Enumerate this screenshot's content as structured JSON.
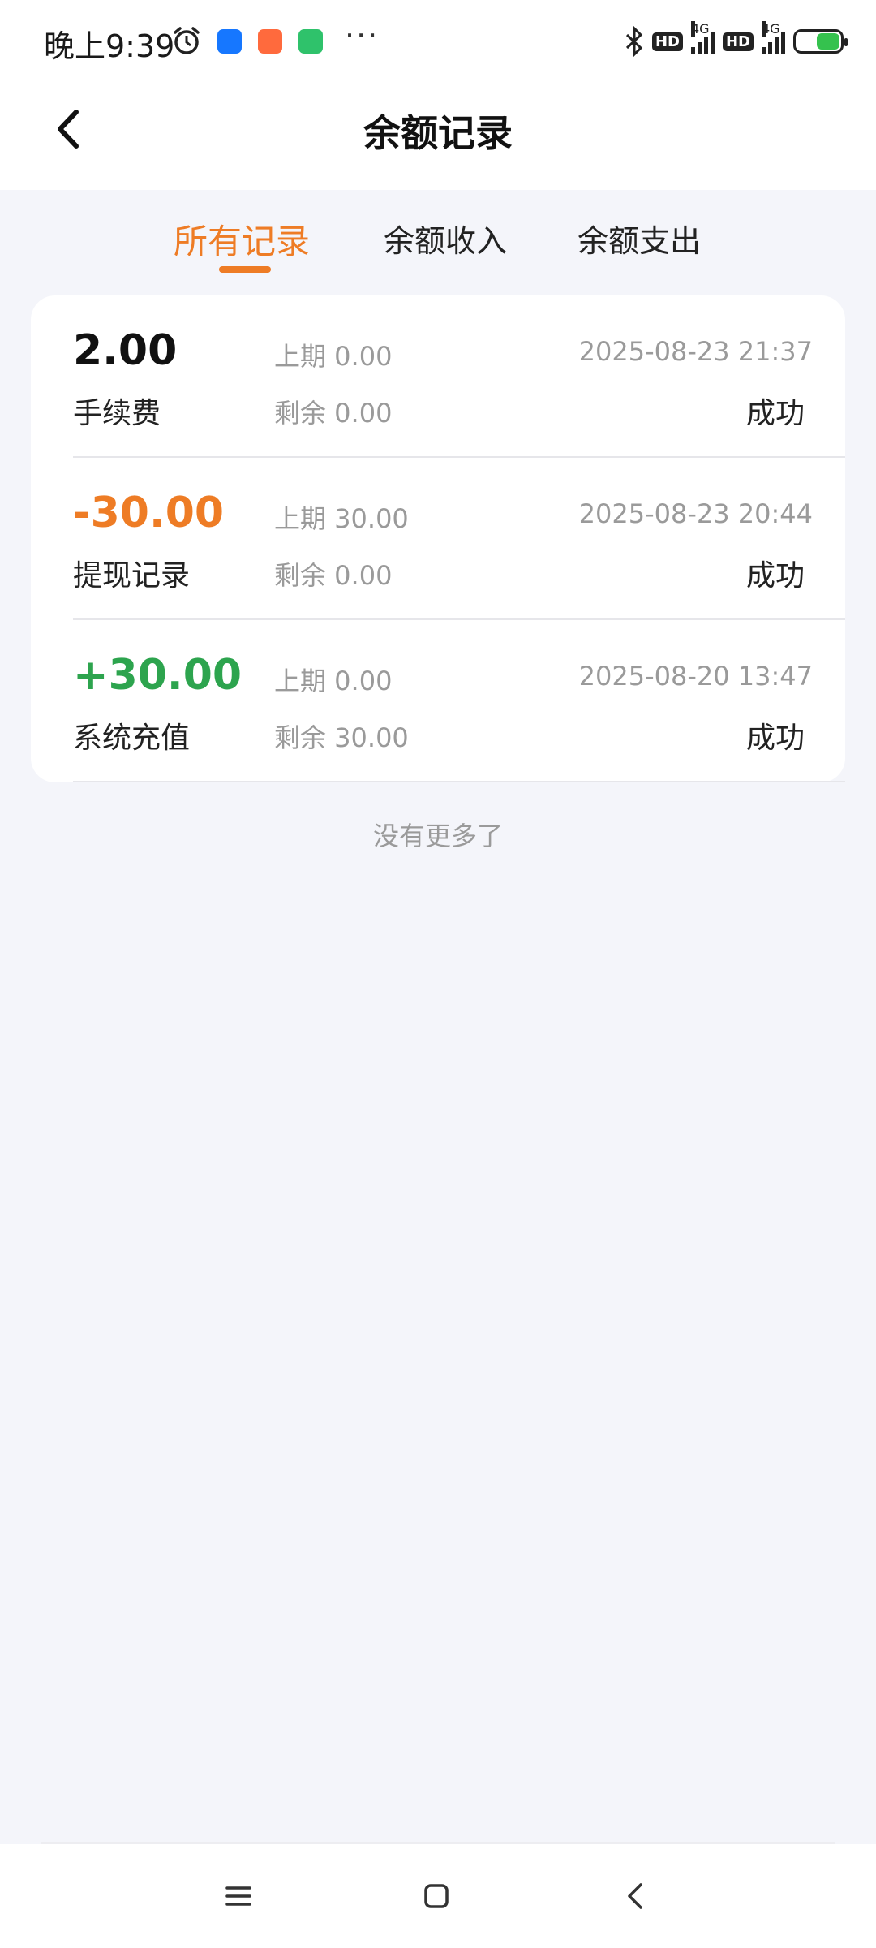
{
  "status_bar": {
    "time": "晚上9:39",
    "more": "···",
    "hd1": "HD",
    "hd2": "HD",
    "net1": "4G",
    "net2": "4G"
  },
  "header": {
    "title": "余额记录",
    "back_icon": "chevron-left-icon"
  },
  "tabs": [
    {
      "label": "所有记录",
      "active": true
    },
    {
      "label": "余额收入",
      "active": false
    },
    {
      "label": "余额支出",
      "active": false
    }
  ],
  "records": [
    {
      "amount": "2.00",
      "amount_color": "#111111",
      "type": "手续费",
      "prev": "上期 0.00",
      "remaining": "剩余 0.00",
      "time": "2025-08-23 21:37",
      "status": "成功"
    },
    {
      "amount": "-30.00",
      "amount_color": "#ee7c25",
      "type": "提现记录",
      "prev": "上期 30.00",
      "remaining": "剩余 0.00",
      "time": "2025-08-23 20:44",
      "status": "成功"
    },
    {
      "amount": "+30.00",
      "amount_color": "#2da44e",
      "type": "系统充值",
      "prev": "上期 0.00",
      "remaining": "剩余 30.00",
      "time": "2025-08-20 13:47",
      "status": "成功"
    }
  ],
  "footer": {
    "no_more": "没有更多了"
  },
  "colors": {
    "accent": "#ee7c25",
    "income": "#2da44e",
    "background": "#f4f5fa"
  },
  "nav": {
    "menu_icon": "menu-icon",
    "home_icon": "home-icon",
    "back_icon": "back-icon"
  }
}
